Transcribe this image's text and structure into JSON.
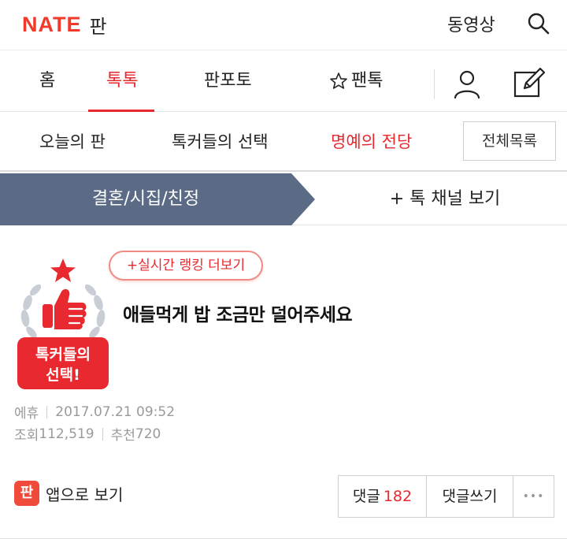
{
  "header": {
    "logo": "NATE",
    "logo_sub": "판",
    "video_label": "동영상"
  },
  "main_nav": {
    "items": [
      {
        "label": "홈"
      },
      {
        "label": "톡톡"
      },
      {
        "label": "판포토"
      },
      {
        "label": "팬톡"
      }
    ],
    "active": "톡톡"
  },
  "sub_nav": {
    "items": [
      {
        "label": "오늘의 판"
      },
      {
        "label": "톡커들의 선택"
      },
      {
        "label": "명예의 전당"
      }
    ],
    "all_list_label": "전체목록"
  },
  "channel_bar": {
    "active_channel": "결혼/시집/친정",
    "more_label": "+ 톡 채널 보기"
  },
  "article": {
    "rank_pill": "+실시간 랭킹 더보기",
    "badge_line1": "톡커들의",
    "badge_line2": "선택!",
    "title": "애들먹게 밥 조금만 덜어주세요",
    "author": "에휴",
    "datetime": "2017.07.21 09:52",
    "views_label": "조회",
    "views": "112,519",
    "recommend_label": "추천",
    "recommend": "720"
  },
  "footer": {
    "app_icon_text": "판",
    "app_view_label": "앱으로 보기",
    "comments_label": "댓글",
    "comments_count": "182",
    "write_comment_label": "댓글쓰기",
    "more_label": "•••"
  },
  "colors": {
    "brand_red": "#e8292f",
    "channel_bar": "#5b6b85"
  }
}
